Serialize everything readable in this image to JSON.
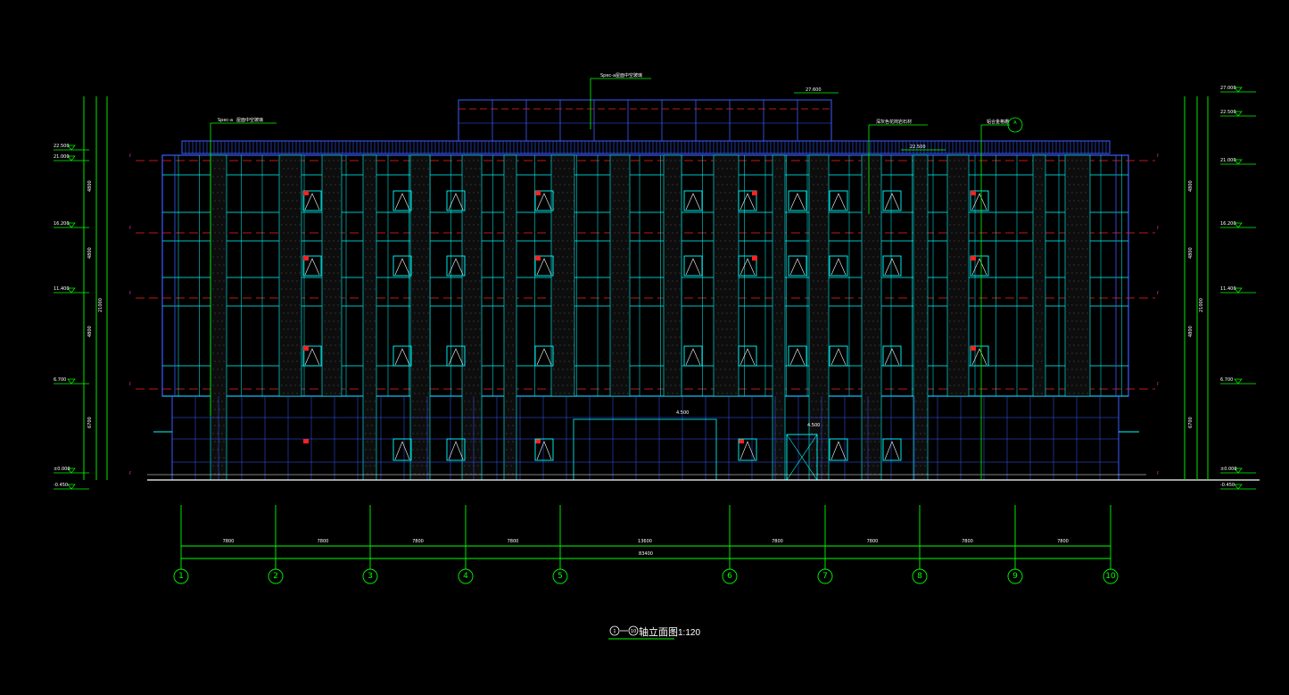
{
  "title": {
    "text": "轴立面图",
    "scale": "1:120",
    "axis_from": "1",
    "axis_to": "10"
  },
  "axes": [
    "1",
    "2",
    "3",
    "4",
    "5",
    "6",
    "7",
    "8",
    "9",
    "10"
  ],
  "bay_dimensions": [
    "7800",
    "7800",
    "7800",
    "7800",
    "13600",
    "7800",
    "7800",
    "7800",
    "7800"
  ],
  "total_dimension": "83400",
  "elevations_left": [
    "22.500",
    "21.000",
    "16.200",
    "11.400",
    "6.700",
    "±0.000",
    "-0.450"
  ],
  "elevations_right": [
    "27.000",
    "22.500",
    "21.000",
    "16.200",
    "11.400",
    "6.700",
    "±0.000",
    "-0.450"
  ],
  "side_dims_left": [
    "4800",
    "4800",
    "4800",
    "6700",
    "21000"
  ],
  "side_dims_right": [
    "4800",
    "4800",
    "4800",
    "6700",
    "21000"
  ],
  "roof_elev": "27.600",
  "parapet_elev": "22.500",
  "entrance_elev": "4.500",
  "callouts": [
    "屋面中空玻璃",
    "屋面中空玻璃",
    "深灰色花岗岩石材",
    "铝合金格栅"
  ],
  "callout_codes": [
    "Spec-a",
    "Spec-a"
  ],
  "section_marker": "A",
  "colors": {
    "green": "#00ff00",
    "cyan": "#00ffff",
    "blue": "#3a5cff",
    "red": "#ff2020",
    "white": "#ffffff",
    "magenta": "#ff3bd0"
  }
}
